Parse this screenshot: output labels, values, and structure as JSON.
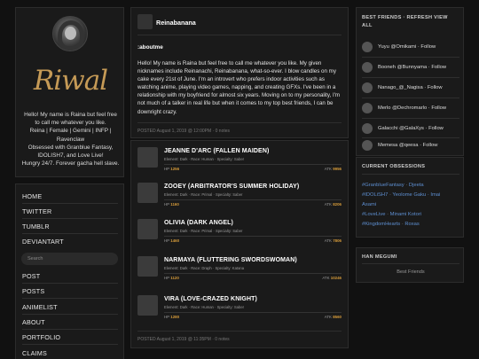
{
  "profile": {
    "logo_text": "Riwal",
    "bio_lines": [
      "Hello! My name is Raina but feel free",
      "to call me whatever you like.",
      "Reina | Female | Gemini | INFP |",
      "Ravenclaw",
      "Obsessed with Granblue Fantasy,",
      "IDOLISH7, and Love Live!",
      "Hungry 24/7. Forever gacha hell slave."
    ]
  },
  "nav": {
    "items_top": [
      "HOME",
      "TWITTER",
      "TUMBLR",
      "DEVIANTART"
    ],
    "search_placeholder": "Search",
    "items_bottom": [
      "POST",
      "POSTS",
      "ANIMELIST",
      "ABOUT",
      "PORTFOLIO",
      "CLAIMS"
    ]
  },
  "post1": {
    "author": "Reinabanana",
    "heading": ":aboutme",
    "body": "Hello! My name is Raina but feel free to call me whatever you like. My given nicknames include Reinanachi, Reinabanana, what-so-ever. I blow candles on my cake every 21st of June. I'm an introvert who prefers indoor activities such as watching anime, playing video games, napping, and creating GFXs. I've been in a relationship with my boyfriend for almost six years. Moving on to my personality, I'm not much of a talker in real life but when it comes to my top best friends, I can be downright crazy.",
    "meta": "POSTED August 1, 2019 @ 12:00PM · 0 notes"
  },
  "post2": {
    "characters": [
      {
        "name": "JEANNE D'ARC (FALLEN MAIDEN)",
        "attr": "Element: Dark · Race: Human · Specialty: Saber",
        "hp_label": "HP",
        "hp": "1256",
        "atk_label": "ATK",
        "atk": "9956"
      },
      {
        "name": "ZOOEY (ARBITRATOR'S SUMMER HOLIDAY)",
        "attr": "Element: Dark · Race: Primal · Specialty: Saber",
        "hp_label": "HP",
        "hp": "1160",
        "atk_label": "ATK",
        "atk": "8206"
      },
      {
        "name": "OLIVIA (DARK ANGEL)",
        "attr": "Element: Dark · Race: Primal · Specialty: Saber",
        "hp_label": "HP",
        "hp": "1460",
        "atk_label": "ATK",
        "atk": "7806"
      },
      {
        "name": "NARMAYA (FLUTTERING SWORDSWOMAN)",
        "attr": "Element: Dark · Race: Draph · Specialty: Katana",
        "hp_label": "HP",
        "hp": "1120",
        "atk_label": "ATK",
        "atk": "10246"
      },
      {
        "name": "VIRA (LOVE-CRAZED KNIGHT)",
        "attr": "Element: Dark · Race: Human · Specialty: Saber",
        "hp_label": "HP",
        "hp": "1280",
        "atk_label": "ATK",
        "atk": "8560"
      }
    ],
    "meta": "POSTED August 1, 2019 @ 11:35PM · 0 notes"
  },
  "friends": {
    "title": "BEST FRIENDS · REFRESH VIEW ALL",
    "items": [
      "Yuyu @Omikami · Follow",
      "Booneh @Bunnyama · Follow",
      "Nanago_@_Nagisa · Follow",
      "Merlo @Dechromarlo · Follow",
      "Galacchi @GalaXys · Follow",
      "Memesa @qeesa · Follow"
    ]
  },
  "obsessions": {
    "title": "CURRENT OBSESSIONS",
    "lines": [
      [
        "#GranblueFantasy",
        "Djeeta"
      ],
      [
        "#IDOLiSH7",
        "Yeolome Gaku · Imai"
      ],
      [
        "Asami"
      ],
      [
        "#LoveLive",
        "Minami Kotori"
      ],
      [
        "#KingdomHearts",
        "Roxas"
      ]
    ]
  },
  "hanmegumi": {
    "title": "HAN MEGUMI",
    "link": "Best Friends"
  },
  "colors": {
    "background": "#111111",
    "panel": "#1a1a1a",
    "accent_gold": "#c59a56",
    "stat_gold": "#d49a3a",
    "link_blue": "#5e8fd1"
  }
}
